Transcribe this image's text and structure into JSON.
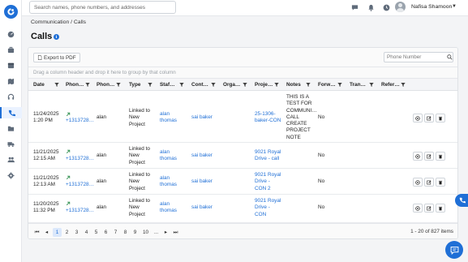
{
  "search": {
    "placeholder": "Search names, phone numbers, and addresses"
  },
  "user": {
    "name": "Nafisa Shamoon"
  },
  "breadcrumb": "Communication / Calls",
  "page": {
    "title": "Calls"
  },
  "toolbar": {
    "export_label": "Export to PDF",
    "phone_placeholder": "Phone Number"
  },
  "group_hint": "Drag a column header and drop it here to group by that column",
  "columns": [
    "Date",
    "Phon…",
    "Phon…",
    "Type",
    "Staf…",
    "Cont…",
    "Orga…",
    "Proje…",
    "Notes",
    "Forw…",
    "Tran…",
    "Refer…"
  ],
  "rows": [
    {
      "date": [
        "11/24/2025",
        "1:20 PM"
      ],
      "phone1": "+1313728…",
      "phone2": "alan",
      "type": [
        "Linked to",
        "New",
        "Project"
      ],
      "staff": [
        "alan",
        "thomas"
      ],
      "contact": "sai baker",
      "project": [
        "25-1306-",
        "baker-CON"
      ],
      "notes": [
        "THIS IS A",
        "TEST FOR",
        "COMMUNI…",
        "CALL",
        "CREATE",
        "PROJECT",
        "NOTE"
      ],
      "forward": "No"
    },
    {
      "date": [
        "11/21/2025",
        "12:15 AM"
      ],
      "phone1": "+1313728…",
      "phone2": "alan",
      "type": [
        "Linked to",
        "New",
        "Project"
      ],
      "staff": [
        "alan",
        "thomas"
      ],
      "contact": "sai baker",
      "project": [
        "9021 Royal",
        "Drive - call"
      ],
      "notes": [],
      "forward": "No"
    },
    {
      "date": [
        "11/21/2025",
        "12:13 AM"
      ],
      "phone1": "+1313728…",
      "phone2": "alan",
      "type": [
        "Linked to",
        "New",
        "Project"
      ],
      "staff": [
        "alan",
        "thomas"
      ],
      "contact": "sai baker",
      "project": [
        "9021 Royal",
        "Drive -",
        "CON 2"
      ],
      "notes": [],
      "forward": "No"
    },
    {
      "date": [
        "11/20/2025",
        "11:32 PM"
      ],
      "phone1": "+1313728…",
      "phone2": "alan",
      "type": [
        "Linked to",
        "New",
        "Project"
      ],
      "staff": [
        "alan",
        "thomas"
      ],
      "contact": "sai baker",
      "project": [
        "9021 Royal",
        "Drive -",
        "CON"
      ],
      "notes": [],
      "forward": "No"
    }
  ],
  "pager": {
    "pages": [
      "1",
      "2",
      "3",
      "4",
      "5",
      "6",
      "7",
      "8",
      "9",
      "10",
      "..."
    ],
    "current": "1",
    "count": "1 - 20 of 827 items"
  },
  "colors": {
    "accent": "#1f6fd6"
  }
}
